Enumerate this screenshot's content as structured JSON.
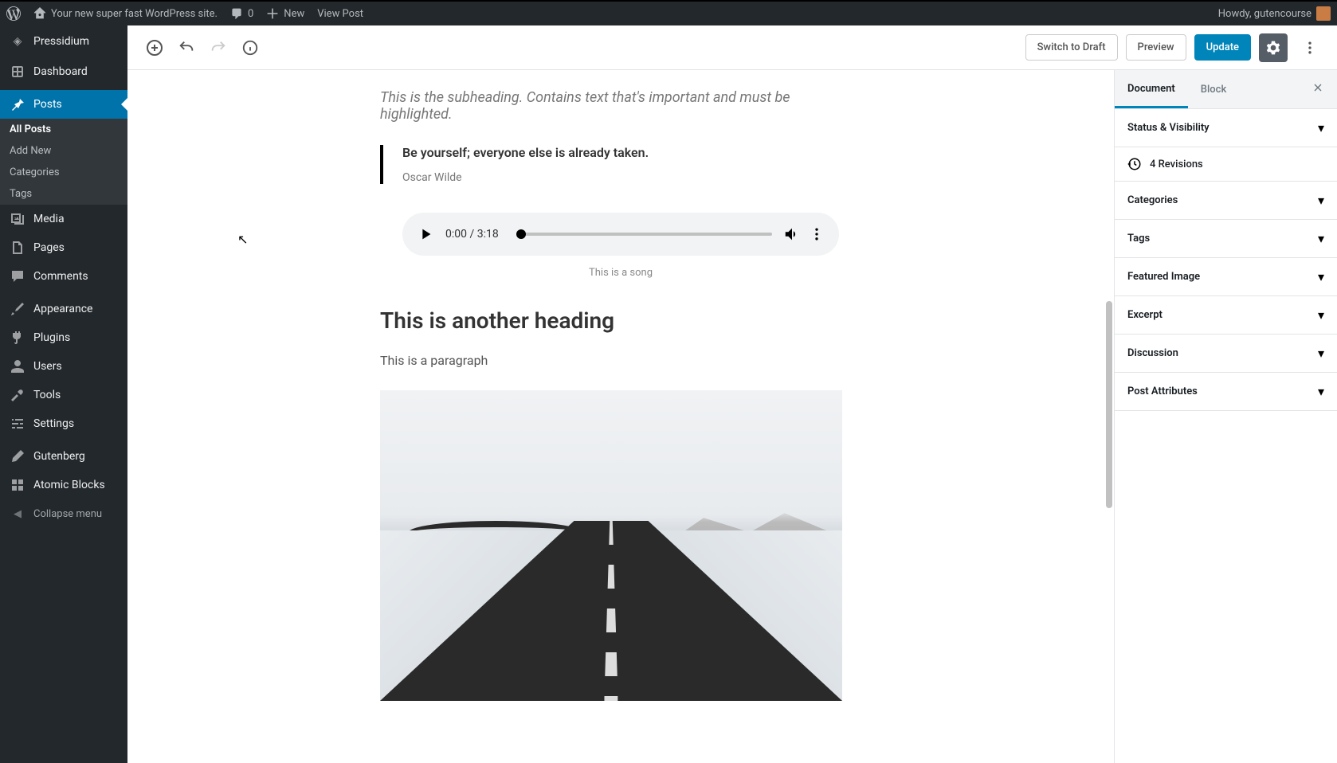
{
  "adminbar": {
    "site_name": "Your new super fast WordPress site.",
    "comments": "0",
    "new": "New",
    "view_post": "View Post",
    "howdy": "Howdy, gutencourse"
  },
  "sidebar": {
    "pressidium": "Pressidium",
    "dashboard": "Dashboard",
    "posts": "Posts",
    "posts_sub": {
      "all": "All Posts",
      "add": "Add New",
      "categories": "Categories",
      "tags": "Tags"
    },
    "media": "Media",
    "pages": "Pages",
    "comments": "Comments",
    "appearance": "Appearance",
    "plugins": "Plugins",
    "users": "Users",
    "tools": "Tools",
    "settings": "Settings",
    "gutenberg": "Gutenberg",
    "atomic": "Atomic Blocks",
    "collapse": "Collapse menu"
  },
  "header": {
    "switch_draft": "Switch to Draft",
    "preview": "Preview",
    "update": "Update"
  },
  "content": {
    "subheading": "This is the subheading. Contains text that's important and must be highlighted.",
    "quote": "Be yourself; everyone else is already taken.",
    "quote_cite": "Oscar Wilde",
    "audio_time": "0:00 / 3:18",
    "audio_caption": "This is a song",
    "heading2": "This is another heading",
    "paragraph": "This is a paragraph"
  },
  "settings": {
    "tab_document": "Document",
    "tab_block": "Block",
    "status_visibility": "Status & Visibility",
    "revisions": "4 Revisions",
    "categories": "Categories",
    "tags": "Tags",
    "featured": "Featured Image",
    "excerpt": "Excerpt",
    "discussion": "Discussion",
    "attributes": "Post Attributes"
  }
}
